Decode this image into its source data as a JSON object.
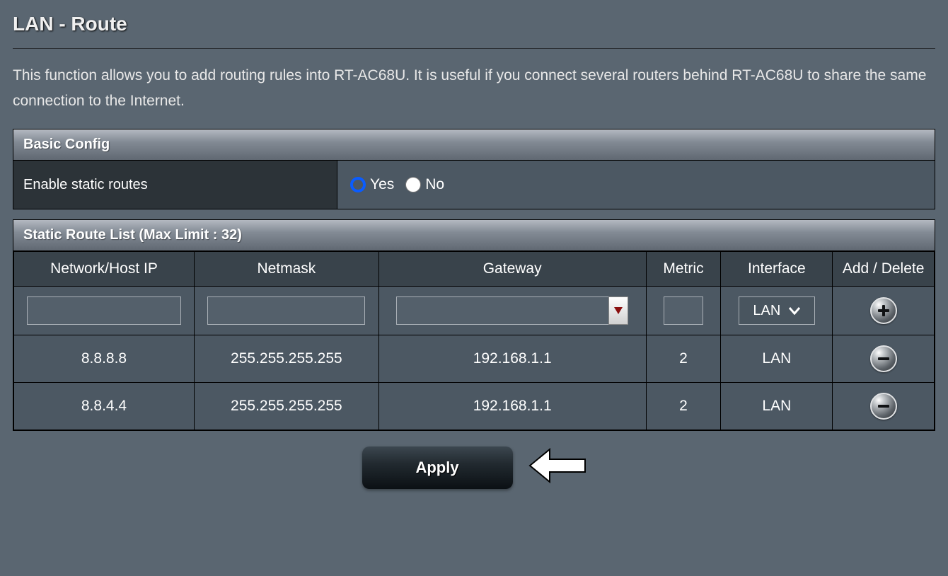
{
  "page_title": "LAN - Route",
  "description": "This function allows you to add routing rules into RT-AC68U. It is useful if you connect several routers behind RT-AC68U to share the same connection to the Internet.",
  "basic_config": {
    "header": "Basic Config",
    "enable_label": "Enable static routes",
    "yes_label": "Yes",
    "no_label": "No",
    "selected": "yes"
  },
  "route_list": {
    "header": "Static Route List (Max Limit : 32)",
    "columns": {
      "ip": "Network/Host IP",
      "netmask": "Netmask",
      "gateway": "Gateway",
      "metric": "Metric",
      "interface": "Interface",
      "action": "Add / Delete"
    },
    "new_row": {
      "ip": "",
      "netmask": "",
      "gateway": "",
      "metric": "",
      "interface": "LAN"
    },
    "rows": [
      {
        "ip": "8.8.8.8",
        "netmask": "255.255.255.255",
        "gateway": "192.168.1.1",
        "metric": "2",
        "interface": "LAN"
      },
      {
        "ip": "8.8.4.4",
        "netmask": "255.255.255.255",
        "gateway": "192.168.1.1",
        "metric": "2",
        "interface": "LAN"
      }
    ]
  },
  "apply_label": "Apply"
}
